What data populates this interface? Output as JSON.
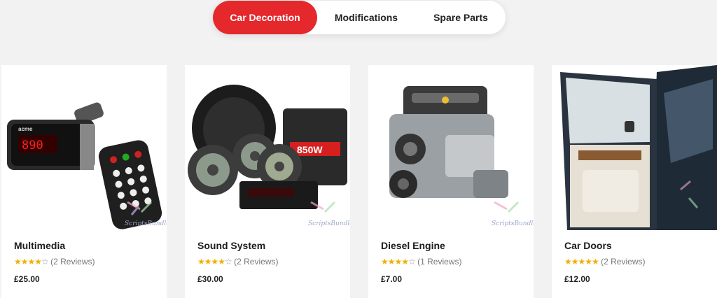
{
  "tabs": [
    {
      "label": "Car Decoration",
      "active": true
    },
    {
      "label": "Modifications",
      "active": false
    },
    {
      "label": "Spare Parts",
      "active": false
    }
  ],
  "accent_color": "#e4282c",
  "products": [
    {
      "name": "Multimedia",
      "stars_full": 4,
      "stars_text": "★★★★",
      "stars_empty_text": "☆",
      "reviews": "(2 Reviews)",
      "price": "£25.00",
      "watermark": "ScriptsBundle"
    },
    {
      "name": "Sound System",
      "stars_full": 4,
      "stars_text": "★★★★",
      "stars_empty_text": "☆",
      "reviews": "(2 Reviews)",
      "price": "£30.00",
      "watermark": "ScriptsBundle"
    },
    {
      "name": "Diesel Engine",
      "stars_full": 4,
      "stars_text": "★★★★",
      "stars_empty_text": "☆",
      "reviews": "(1 Reviews)",
      "price": "£7.00",
      "watermark": "ScriptsBundle"
    },
    {
      "name": "Car Doors",
      "stars_full": 5,
      "stars_text": "★★★★★",
      "stars_empty_text": "",
      "reviews": "(2 Reviews)",
      "price": "£12.00"
    }
  ]
}
